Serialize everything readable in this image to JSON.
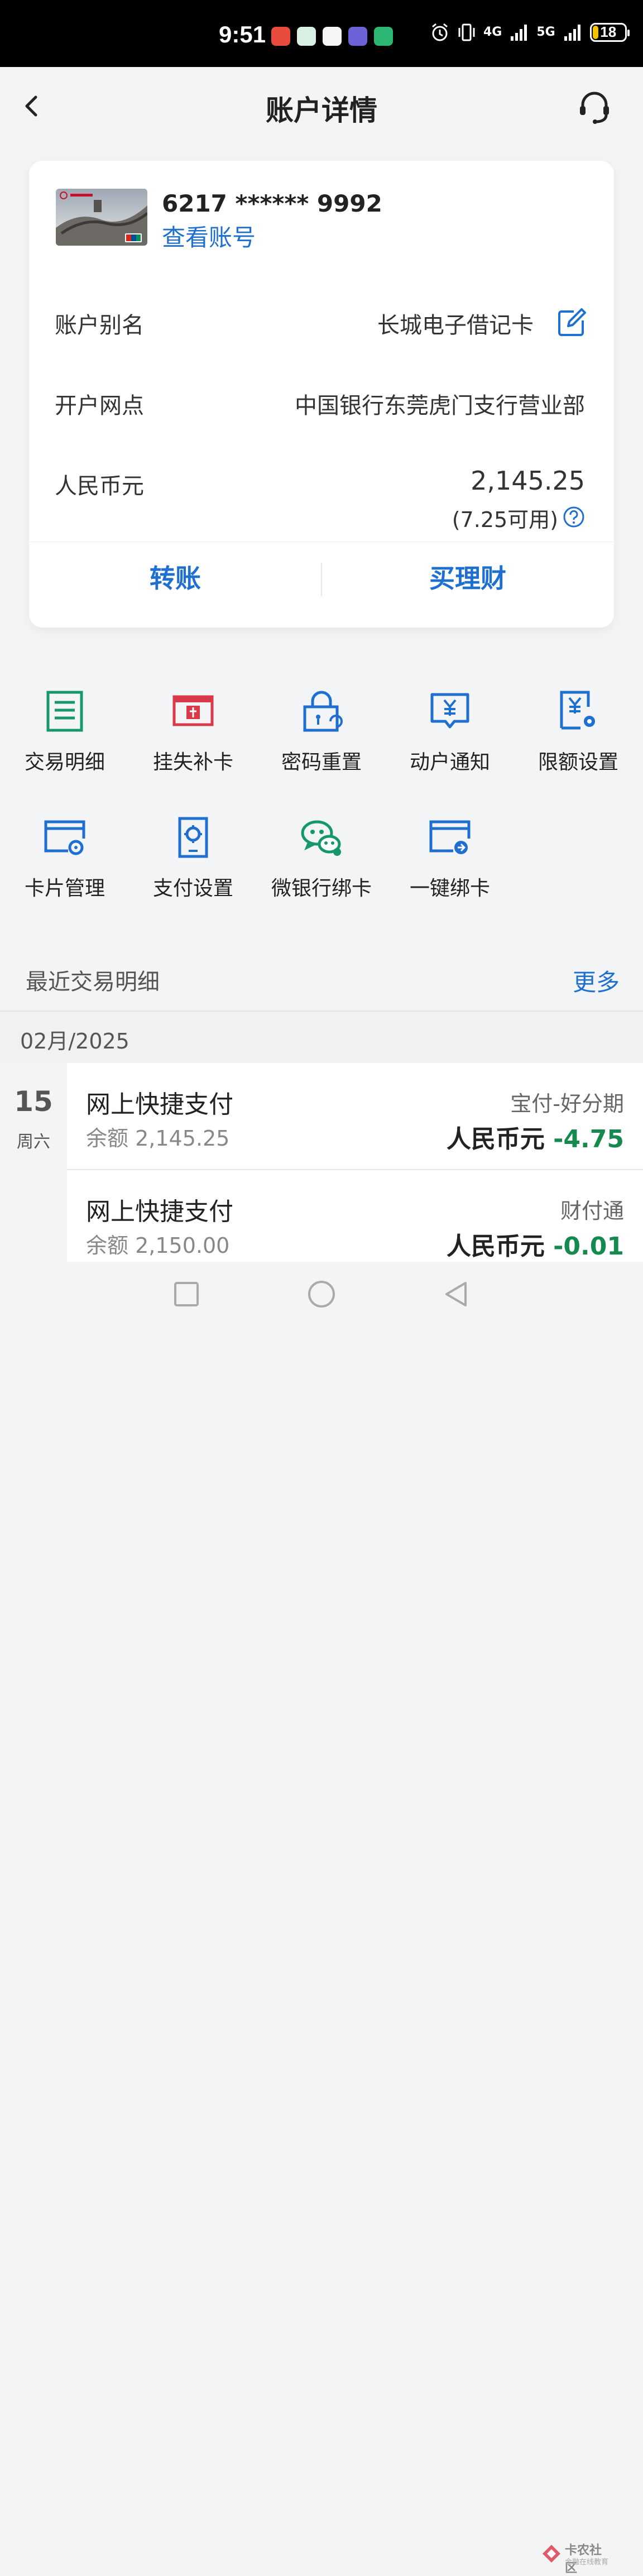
{
  "status_bar": {
    "time": "9:51",
    "network_labels": [
      "4G",
      "5G"
    ],
    "battery": "18",
    "battery_level": 0.18
  },
  "header": {
    "title": "账户详情"
  },
  "account_card": {
    "card_number": "6217 ****** 9992",
    "view_number_link": "查看账号",
    "rows": [
      {
        "label": "账户别名",
        "value": "长城电子借记卡"
      },
      {
        "label": "开户网点",
        "value": "中国银行东莞虎门支行营业部"
      },
      {
        "label": "人民币元",
        "value": "2,145.25"
      }
    ],
    "available": "(7.25可用)",
    "actions": [
      "转账",
      "买理财"
    ]
  },
  "services": [
    {
      "label": "交易明细",
      "icon": "list-icon",
      "color": "#16976a"
    },
    {
      "label": "挂失补卡",
      "icon": "card-replace-icon",
      "color": "#d83a4a"
    },
    {
      "label": "密码重置",
      "icon": "lock-reset-icon",
      "color": "#1f6fd1"
    },
    {
      "label": "动户通知",
      "icon": "yuan-message-icon",
      "color": "#1f6fd1"
    },
    {
      "label": "限额设置",
      "icon": "yuan-settings-icon",
      "color": "#1f6fd1"
    },
    {
      "label": "卡片管理",
      "icon": "card-settings-icon",
      "color": "#1f6fd1"
    },
    {
      "label": "支付设置",
      "icon": "phone-settings-icon",
      "color": "#1f6fd1"
    },
    {
      "label": "微银行绑卡",
      "icon": "wechat-icon",
      "color": "#16976a"
    },
    {
      "label": "一键绑卡",
      "icon": "card-link-icon",
      "color": "#1f6fd1"
    }
  ],
  "recent": {
    "title": "最近交易明细",
    "more": "更多",
    "month": "02月/2025",
    "day": "15",
    "weekday": "周六",
    "transactions": [
      {
        "name": "网上快捷支付",
        "balance": "余额 2,145.25",
        "merchant": "宝付-好分期",
        "currency": "人民币元",
        "amount": "-4.75"
      },
      {
        "name": "网上快捷支付",
        "balance": "余额 2,150.00",
        "merchant": "财付通",
        "currency": "人民币元",
        "amount": "-0.01"
      }
    ]
  },
  "watermark": {
    "title": "卡农社区",
    "subtitle": "金融在线教育"
  },
  "colors": {
    "accent": "#1f6fd1",
    "negative_amount": "#168a4e",
    "background": "#f3f4f6"
  }
}
